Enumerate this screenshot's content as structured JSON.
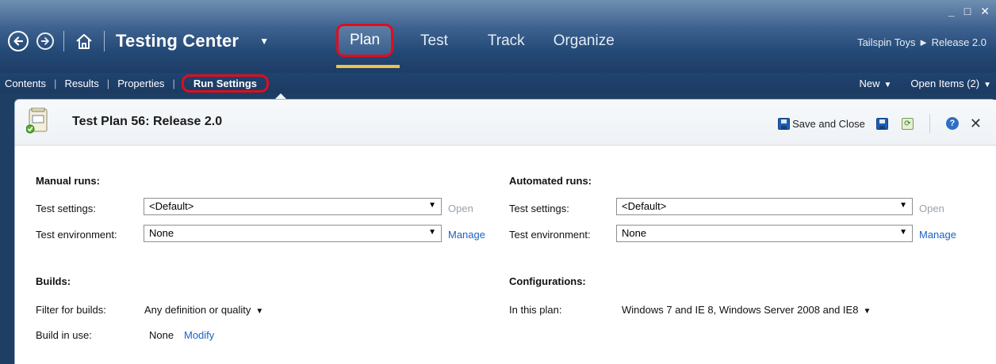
{
  "window": {
    "minimize_glyph": "_",
    "maximize_glyph": "□",
    "close_glyph": "✕"
  },
  "header": {
    "app_title": "Testing Center",
    "tabs": [
      {
        "label": "Plan",
        "active": true
      },
      {
        "label": "Test"
      },
      {
        "label": "Track"
      },
      {
        "label": "Organize"
      }
    ],
    "project_crumb": "Tailspin Toys ► Release 2.0"
  },
  "subnav": {
    "items": [
      {
        "label": "Contents"
      },
      {
        "label": "Results"
      },
      {
        "label": "Properties"
      },
      {
        "label": "Run Settings",
        "active": true
      }
    ],
    "new_label": "New",
    "open_items_label": "Open Items (2)"
  },
  "document": {
    "title": "Test Plan 56: Release 2.0",
    "save_and_close_label": "Save and Close",
    "help_glyph": "?",
    "close_glyph": "✕"
  },
  "manual_runs": {
    "heading": "Manual runs:",
    "test_settings_label": "Test settings:",
    "test_settings_value": "<Default>",
    "open_label": "Open",
    "test_environment_label": "Test environment:",
    "test_environment_value": "None",
    "manage_label": "Manage"
  },
  "automated_runs": {
    "heading": "Automated runs:",
    "test_settings_label": "Test settings:",
    "test_settings_value": "<Default>",
    "open_label": "Open",
    "test_environment_label": "Test environment:",
    "test_environment_value": "None",
    "manage_label": "Manage"
  },
  "builds": {
    "heading": "Builds:",
    "filter_label": "Filter for builds:",
    "filter_value": "Any definition or quality",
    "build_in_use_label": "Build in use:",
    "build_in_use_value": "None",
    "modify_label": "Modify"
  },
  "configurations": {
    "heading": "Configurations:",
    "in_plan_label": "In this plan:",
    "in_plan_value": "Windows 7 and IE 8, Windows Server 2008 and IE8"
  },
  "colors": {
    "header_dark": "#1d3d66",
    "header_light": "#6f8fb1",
    "highlight_red": "#e10d1d",
    "active_underline": "#f1c248",
    "link_blue": "#1a63c4"
  }
}
